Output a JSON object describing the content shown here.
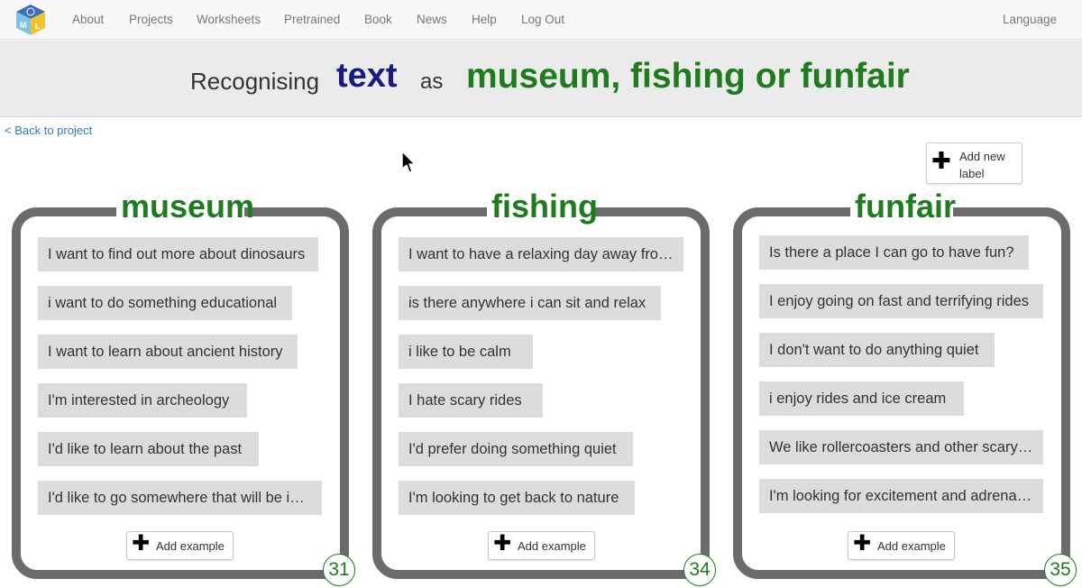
{
  "nav": {
    "items": [
      "About",
      "Projects",
      "Worksheets",
      "Pretrained",
      "Book",
      "News",
      "Help",
      "Log Out"
    ],
    "language": "Language"
  },
  "banner": {
    "recognising": "Recognising",
    "type": "text",
    "as": "as",
    "labels": "museum, fishing or funfair"
  },
  "back_link": "< Back to project",
  "add_label": {
    "label": "Add new label"
  },
  "columns": [
    {
      "title": "museum",
      "examples": [
        "I want to find out more about dinosaurs",
        "i want to do something educational",
        "I want to learn about ancient history",
        "I'm interested in archeology",
        "I'd like to learn about the past",
        "I'd like to go somewhere that will be interesting"
      ],
      "add_example": "Add example",
      "count": "31"
    },
    {
      "title": "fishing",
      "examples": [
        "I want to have a relaxing day away from it all",
        "is there anywhere i can sit and relax",
        "i like to be calm",
        "I hate scary rides",
        "I'd prefer doing something quiet",
        "I'm looking to get back to nature"
      ],
      "add_example": "Add example",
      "count": "34"
    },
    {
      "title": "funfair",
      "examples": [
        "Is there a place I can go to have fun?",
        "I enjoy going on fast and terrifying rides",
        "I don't want to do anything quiet",
        "i enjoy rides and ice cream",
        "We like rollercoasters and other scary rides",
        "I'm looking for excitement and adrenaline"
      ],
      "add_example": "Add example",
      "count": "35"
    }
  ],
  "colors": {
    "label_green": "#1e7b1e",
    "type_navy": "#1a1a80",
    "link_blue": "#337ab7",
    "column_border": "#6b6b6b",
    "example_bg": "#dcdcdc"
  }
}
